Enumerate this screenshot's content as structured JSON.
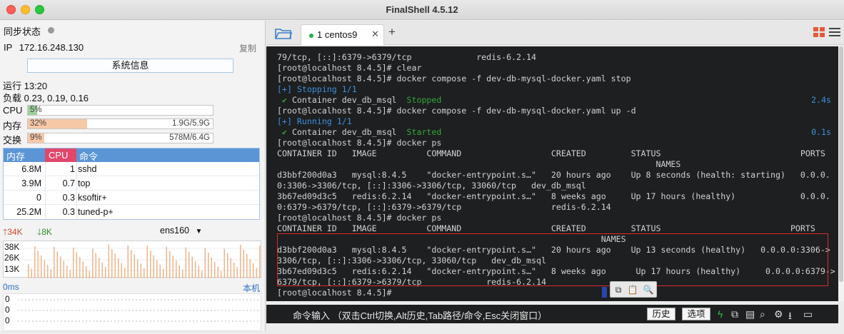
{
  "window": {
    "title": "FinalShell 4.5.12"
  },
  "left": {
    "sync_label": "同步状态",
    "ip_prefix": "IP",
    "ip": "172.16.248.130",
    "copy": "复制",
    "sysinfo_button": "系统信息",
    "uptime": "运行 13:20",
    "load": "负载 0.23, 0.19, 0.16",
    "cpu": {
      "label": "CPU",
      "pct": "5%",
      "fraction": 0.05,
      "color": "#9ed29e"
    },
    "mem": {
      "label": "内存",
      "pct": "32%",
      "fraction": 0.32,
      "value": "1.9G/5.9G",
      "color": "#f7c8a6"
    },
    "swap": {
      "label": "交换",
      "pct": "9%",
      "fraction": 0.09,
      "value": "578M/6.4G",
      "color": "#f7c8a6"
    },
    "proc_headers": [
      "内存",
      "CPU",
      "命令"
    ],
    "procs": [
      {
        "mem": "6.8M",
        "cpu": "1",
        "cmd": "sshd"
      },
      {
        "mem": "3.9M",
        "cpu": "0.7",
        "cmd": "top"
      },
      {
        "mem": "0",
        "cpu": "0.3",
        "cmd": "ksoftir+"
      },
      {
        "mem": "25.2M",
        "cpu": "0.3",
        "cmd": "tuned-p+"
      }
    ],
    "net": {
      "up": "34K",
      "down": "8K",
      "iface": "ens160",
      "scale": [
        "38K",
        "26K",
        "13K"
      ]
    },
    "latency": {
      "left_label": "0ms",
      "right_label": "本机",
      "values": [
        "0",
        "0",
        "0"
      ]
    }
  },
  "tabs": [
    {
      "label": "1 centos9",
      "close": "✕"
    }
  ],
  "tab_add": "+",
  "terminal": {
    "lines": [
      {
        "t": "79/tcp, [::]:6379->6379/tcp             redis-6.2.14",
        "c": ""
      },
      {
        "t": "[root@localhost 8.4.5]# clear",
        "c": ""
      },
      {
        "t": "[root@localhost 8.4.5]# docker compose -f dev-db-mysql-docker.yaml stop",
        "c": ""
      },
      {
        "t": "[+] Stopping 1/1",
        "c": "blue"
      },
      {
        "t": " ✔ Container dev_db_msql  ",
        "c": "green-start",
        "extra": "Stopped",
        "right": "2.4s"
      },
      {
        "t": "[root@localhost 8.4.5]# docker compose -f dev-db-mysql-docker.yaml up -d",
        "c": ""
      },
      {
        "t": "[+] Running 1/1",
        "c": "blue"
      },
      {
        "t": " ✔ Container dev_db_msql  ",
        "c": "green-start",
        "extra": "Started",
        "right": "0.1s"
      },
      {
        "t": "[root@localhost 8.4.5]# docker ps",
        "c": ""
      },
      {
        "t": "CONTAINER ID   IMAGE          COMMAND                  CREATED         STATUS                            PORTS",
        "c": ""
      },
      {
        "t": "                                                                            NAMES",
        "c": ""
      },
      {
        "t": "d3bbf200d0a3   mysql:8.4.5    \"docker-entrypoint.s…\"   20 hours ago    Up 8 seconds (health: starting)   0.0.0.",
        "c": ""
      },
      {
        "t": "0:3306->3306/tcp, [::]:3306->3306/tcp, 33060/tcp   dev_db_msql",
        "c": ""
      },
      {
        "t": "3b67ed09d3c5   redis:6.2.14   \"docker-entrypoint.s…\"   8 weeks ago     Up 17 hours (healthy)             0.0.0.",
        "c": ""
      },
      {
        "t": "0:6379->6379/tcp, [::]:6379->6379/tcp                  redis-6.2.14",
        "c": ""
      },
      {
        "t": "[root@localhost 8.4.5]# docker ps",
        "c": ""
      },
      {
        "t": "CONTAINER ID   IMAGE          COMMAND                  CREATED         STATUS                          PORTS",
        "c": ""
      },
      {
        "t": "                                                                 NAMES",
        "c": ""
      },
      {
        "t": "d3bbf200d0a3   mysql:8.4.5    \"docker-entrypoint.s…\"   20 hours ago    Up 13 seconds (healthy)   0.0.0.0:3306->",
        "c": ""
      },
      {
        "t": "3306/tcp, [::]:3306->3306/tcp, 33060/tcp   dev_db_msql",
        "c": ""
      },
      {
        "t": "3b67ed09d3c5   redis:6.2.14   \"docker-entrypoint.s…\"   8 weeks ago      Up 17 hours (healthy)     0.0.0.0:6379->",
        "c": ""
      },
      {
        "t": "6379/tcp, [::]:6379->6379/tcp             redis-6.2.14",
        "c": ""
      },
      {
        "t": "[root@localhost 8.4.5]# ",
        "c": ""
      }
    ]
  },
  "cmdbar": {
    "hint": "命令输入 （双击Ctrl切换,Alt历史,Tab路径/命令,Esc关闭窗口）",
    "history": "历史",
    "options": "选项"
  },
  "colors": {
    "accent": "#5b95d6",
    "cpu_sel": "#e0476b",
    "term_bg": "#1d1f20",
    "highlight": "#e02c2c"
  }
}
